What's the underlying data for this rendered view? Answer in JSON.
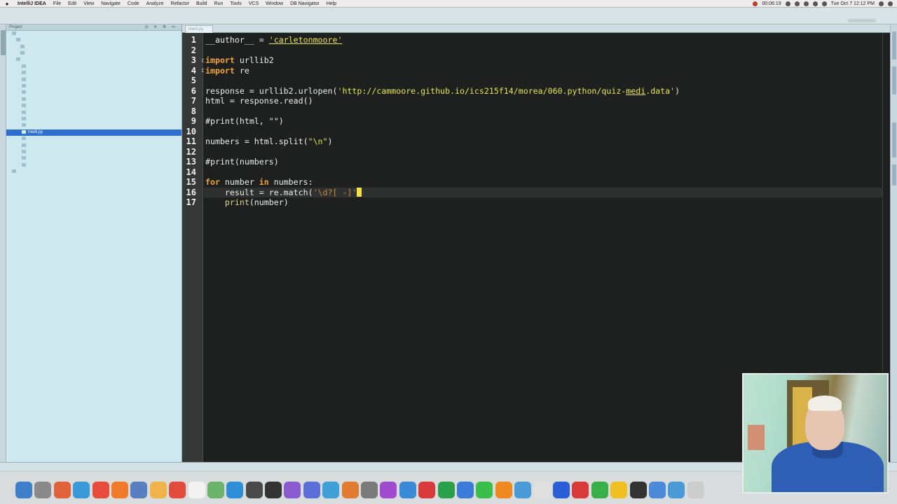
{
  "menubar": {
    "apple": "",
    "items": [
      "IntelliJ IDEA",
      "File",
      "Edit",
      "View",
      "Navigate",
      "Code",
      "Analyze",
      "Refactor",
      "Build",
      "Run",
      "Tools",
      "VCS",
      "Window",
      "DB Navigator",
      "Help"
    ],
    "clock_left": "00:06:19",
    "clock_right": "Tue Oct 7  12:12 PM"
  },
  "project_panel": {
    "header_label": "Project",
    "controls": "◎ ≑ ⚙ ↤",
    "selected_file": "medi.py"
  },
  "editor": {
    "tab_label": "medi.py",
    "line_numbers": [
      "1",
      "2",
      "3",
      "4",
      "5",
      "6",
      "7",
      "8",
      "9",
      "10",
      "11",
      "12",
      "13",
      "14",
      "15",
      "16",
      "17"
    ],
    "current_line": 16
  },
  "code_lines": {
    "l1_a": "__author__ = ",
    "l1_str": "'carletonmoore'",
    "l3_kw": "import",
    "l3_rest": " urllib2",
    "l4_kw": "import",
    "l4_rest": " re",
    "l6_a": "response = urllib2.urlopen(",
    "l6_str_a": "'http://cammoore.github.io/ics215f14/morea/060.python/quiz-",
    "l6_link": "medi",
    "l6_str_b": ".data'",
    "l6_b": ")",
    "l7": "html = response.read()",
    "l9": "#print(html, \"\")",
    "l11_a": "numbers = html.split(",
    "l11_str": "\"\\n\"",
    "l11_b": ")",
    "l13": "#print(numbers)",
    "l15_kw1": "for",
    "l15_a": " number ",
    "l15_kw2": "in",
    "l15_b": " numbers:",
    "l16_indent": "    ",
    "l16_a": "result = re.match(",
    "l16_str": "'\\d?[ -]'",
    "l17_indent": "    ",
    "l17_fn": "print",
    "l17_rest": "(number)"
  },
  "colors": {
    "keyword": "#f2a33a",
    "string": "#e6e64e",
    "editor_bg": "#1e1f1f",
    "selection": "#2e6fd2"
  },
  "dock": {
    "icon_colors": [
      "#3f7fc9",
      "#8a8a8a",
      "#e0613a",
      "#3a9ad9",
      "#e74c3c",
      "#f07a2a",
      "#5a7fc0",
      "#f0b44a",
      "#e24a3a",
      "#f2f2f2",
      "#6bb36b",
      "#2e8fd8",
      "#4a4a4a",
      "#333333",
      "#8a5ad0",
      "#5a6fd8",
      "#3fa0d8",
      "#e07a30",
      "#7a7a7a",
      "#a04ad0",
      "#3a8ad8",
      "#d83a3a",
      "#2aa04a",
      "#3a7ad8",
      "#3ac04a",
      "#f08a20",
      "#4a9ad8",
      "#e0e0e0",
      "#2a5fd8",
      "#d83a3a",
      "#3ab04a",
      "#f0c020",
      "#333333",
      "#4a8ad8",
      "#4a9ad8",
      "#cccccc"
    ]
  }
}
